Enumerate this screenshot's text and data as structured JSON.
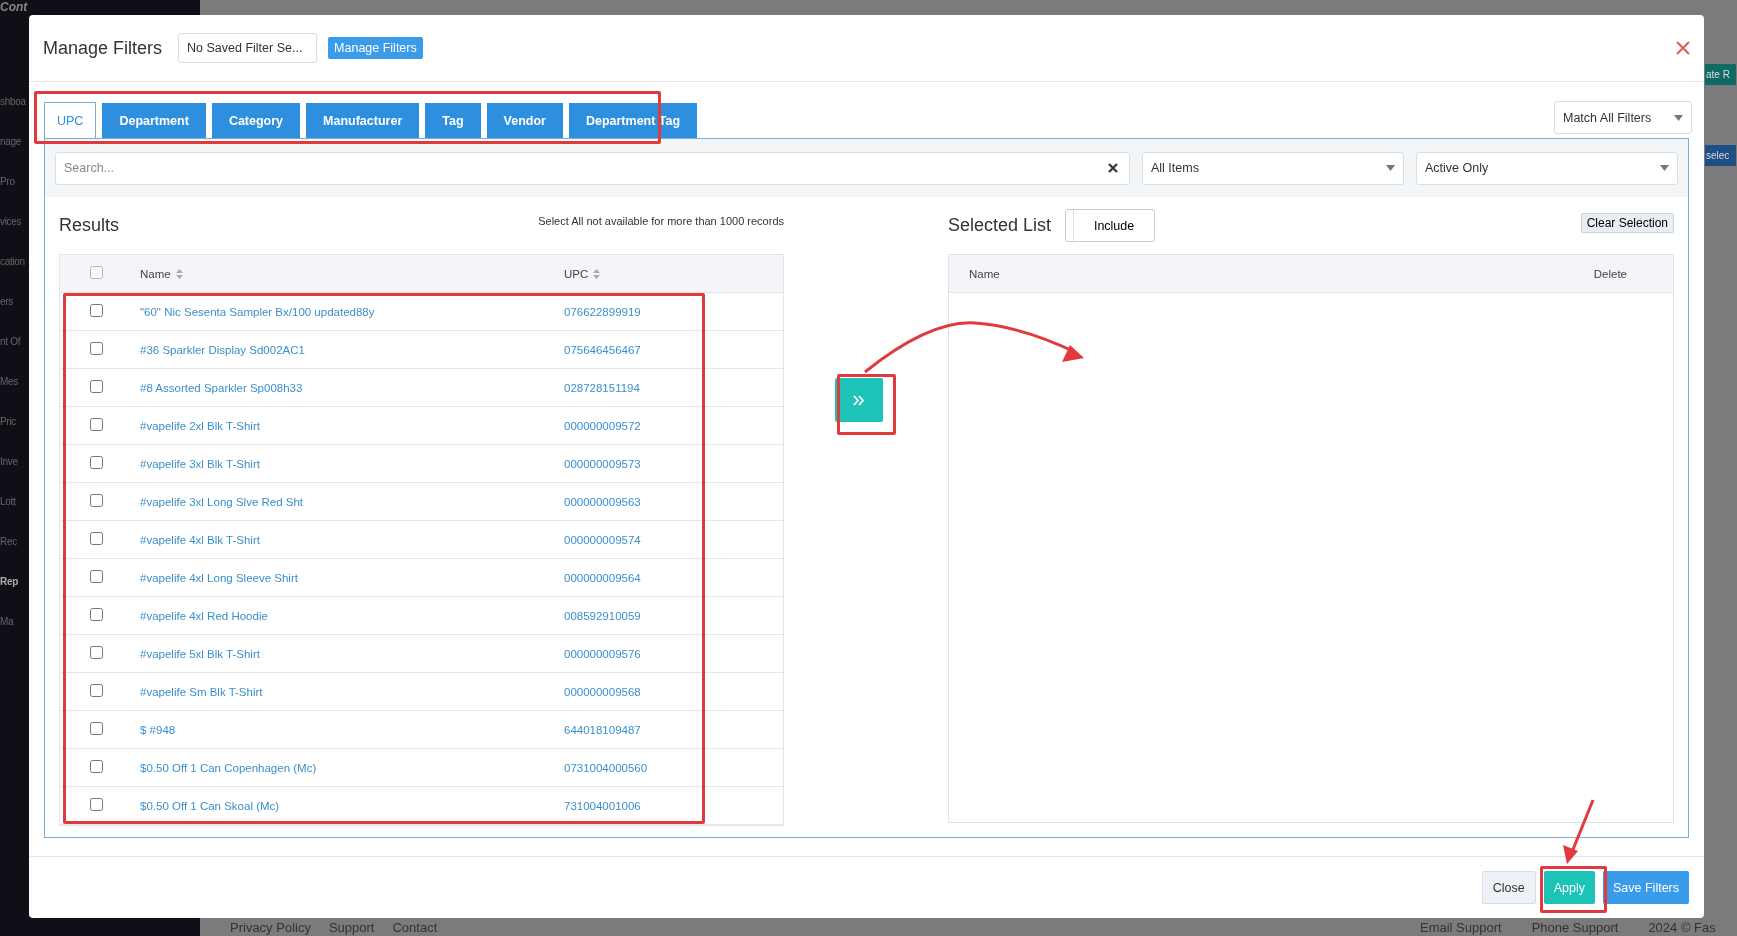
{
  "background": {
    "brand": "Cont",
    "sidebar_items": [
      {
        "label": "shboa",
        "selected": false
      },
      {
        "label": "nage",
        "selected": false
      },
      {
        "label": "Pro",
        "selected": false
      },
      {
        "label": "vices",
        "selected": false
      },
      {
        "label": "cation",
        "selected": false
      },
      {
        "label": "ers",
        "selected": false
      },
      {
        "label": "nt Of",
        "selected": false
      },
      {
        "label": "Mes",
        "selected": false
      },
      {
        "label": "Pric",
        "selected": false
      },
      {
        "label": "Inve",
        "selected": false
      },
      {
        "label": "Lott",
        "selected": false
      },
      {
        "label": "Rec",
        "selected": false
      },
      {
        "label": "Rep",
        "selected": true
      },
      {
        "label": "Ma",
        "selected": false
      }
    ],
    "side_buttons": [
      {
        "label": "ate R",
        "kind": "teal"
      },
      {
        "label": "selec",
        "kind": "blue"
      }
    ],
    "footer_links": [
      "Privacy Policy",
      "Support",
      "Contact"
    ],
    "footer_support": [
      "Email Support",
      "Phone Support"
    ],
    "copyright": "2024 © Fas"
  },
  "modal": {
    "title": "Manage Filters",
    "saved_filter": "No Saved Filter Se...",
    "manage_button": "Manage Filters",
    "tabs": [
      {
        "label": "UPC",
        "selected": true
      },
      {
        "label": "Department",
        "selected": false
      },
      {
        "label": "Category",
        "selected": false
      },
      {
        "label": "Manufacturer",
        "selected": false
      },
      {
        "label": "Tag",
        "selected": false
      },
      {
        "label": "Vendor",
        "selected": false
      },
      {
        "label": "Department Tag",
        "selected": false
      }
    ],
    "match_mode": "Match All Filters",
    "search": {
      "placeholder": "Search..."
    },
    "item_filter": "All Items",
    "status_filter": "Active Only",
    "results": {
      "title": "Results",
      "note": "Select All not available for more than 1000 records",
      "select_all": {
        "checked": false
      },
      "columns": [
        "Name",
        "UPC"
      ],
      "rows": [
        {
          "name": "\"60\" Nic Sesenta Sampler Bx/100 updated88y",
          "upc": "076622899919",
          "checked": false
        },
        {
          "name": "#36 Sparkler Display Sd002AC1",
          "upc": "075646456467",
          "checked": false
        },
        {
          "name": "#8 Assorted Sparkler Sp008h33",
          "upc": "028728151194",
          "checked": false
        },
        {
          "name": "#vapelife 2xl Blk T-Shirt",
          "upc": "000000009572",
          "checked": false
        },
        {
          "name": "#vapelife 3xl Blk T-Shirt",
          "upc": "000000009573",
          "checked": false
        },
        {
          "name": "#vapelife 3xl Long Slve Red Sht",
          "upc": "000000009563",
          "checked": false
        },
        {
          "name": "#vapelife 4xl Blk T-Shirt",
          "upc": "000000009574",
          "checked": false
        },
        {
          "name": "#vapelife 4xl Long Sleeve Shirt",
          "upc": "000000009564",
          "checked": false
        },
        {
          "name": "#vapelife 4xl Red Hoodie",
          "upc": "008592910059",
          "checked": false
        },
        {
          "name": "#vapelife 5xl Blk T-Shirt",
          "upc": "000000009576",
          "checked": false
        },
        {
          "name": "#vapelife Sm Blk T-Shirt",
          "upc": "000000009568",
          "checked": false
        },
        {
          "name": "$ #948",
          "upc": "644018109487",
          "checked": false
        },
        {
          "name": "$0.50 Off 1 Can Copenhagen (Mc)",
          "upc": "0731004000560",
          "checked": false
        },
        {
          "name": "$0.50 Off 1 Can Skoal (Mc)",
          "upc": "731004001006",
          "checked": false
        }
      ]
    },
    "selected_list": {
      "title": "Selected List",
      "mode": "Include",
      "clear_button": "Clear Selection",
      "columns": [
        "Name",
        "Delete"
      ]
    },
    "footer_buttons": [
      {
        "label": "Close",
        "kind": "default"
      },
      {
        "label": "Apply",
        "kind": "teal"
      },
      {
        "label": "Save Filters",
        "kind": "primary"
      }
    ]
  }
}
